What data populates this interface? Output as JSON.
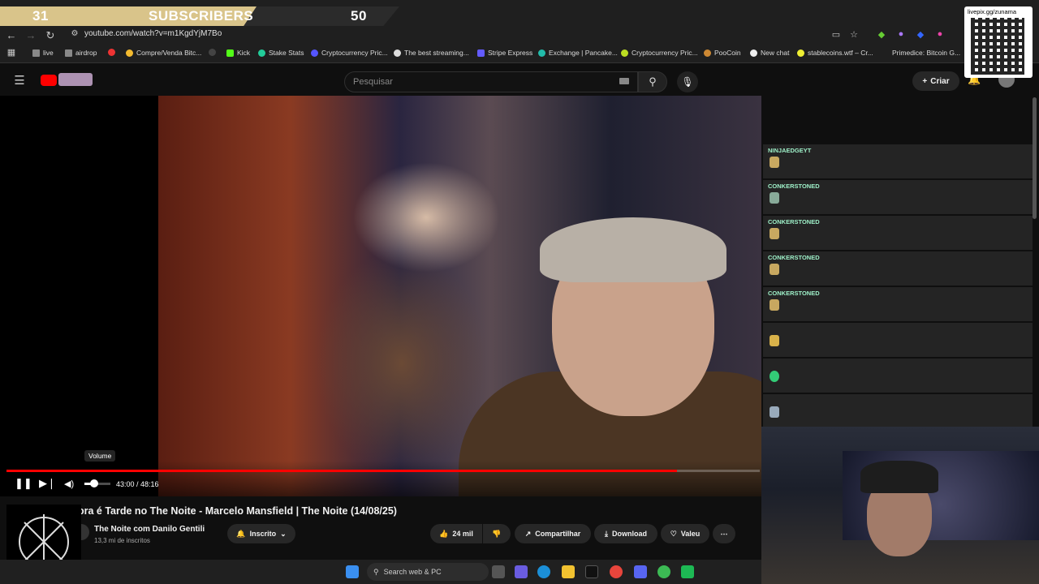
{
  "subscriber_goal": {
    "current": "31",
    "label": "SUBSCRIBERS",
    "target": "50"
  },
  "browser": {
    "url": "youtube.com/watch?v=m1KgdYjM7Bo",
    "bookmarks": [
      "live",
      "airdrop",
      "Compre/Venda Bitc...",
      "Kick",
      "Stake Stats",
      "Cryptocurrency Pric...",
      "The best streaming...",
      "Stripe Express",
      "Exchange | Pancake...",
      "Cryptocurrency Pric...",
      "PooCoin",
      "New chat",
      "stablecoins.wtf – Cr...",
      "Primedice: Bitcoin G..."
    ]
  },
  "youtube": {
    "search_placeholder": "Pesquisar",
    "create_label": "Criar"
  },
  "player": {
    "time": "43:00 / 48:16",
    "volume_tooltip": "Volume",
    "progress": 0.89,
    "volume": 0.35
  },
  "video": {
    "title": "ora é Tarde no The Noite - Marcelo Mansfield | The Noite (14/08/25)",
    "channel": "The Noite com Danilo Gentili",
    "subscribers": "13,3 mi de inscritos",
    "subscribed_label": "Inscrito",
    "likes": "24 mil",
    "share_label": "Compartilhar",
    "download_label": "Download",
    "thanks_label": "Valeu"
  },
  "chat": [
    {
      "name": "NINJAEDGEYT",
      "color": "#9ef0c8"
    },
    {
      "name": "CONKERSTONED",
      "color": "#9ef0c8"
    },
    {
      "name": "CONKERSTONED",
      "color": "#9ef0c8"
    },
    {
      "name": "CONKERSTONED",
      "color": "#9ef0c8"
    },
    {
      "name": "CONKERSTONED",
      "color": "#9ef0c8"
    }
  ],
  "qr_label": "livepix.gg/zunama",
  "taskbar": {
    "search_placeholder": "Search web & PC"
  }
}
